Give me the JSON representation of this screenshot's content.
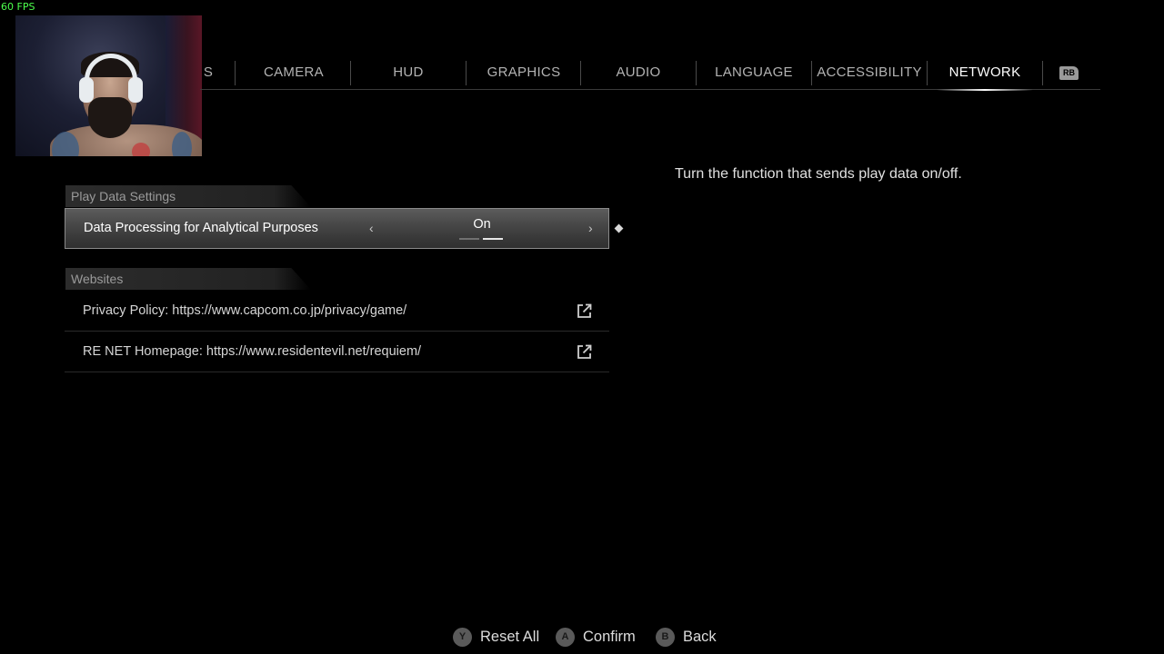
{
  "overlay": {
    "fps": "60 FPS"
  },
  "tabs": [
    {
      "label": "S"
    },
    {
      "label": "CAMERA"
    },
    {
      "label": "HUD"
    },
    {
      "label": "GRAPHICS"
    },
    {
      "label": "AUDIO"
    },
    {
      "label": "LANGUAGE"
    },
    {
      "label": "ACCESSIBILITY"
    },
    {
      "label": "NETWORK"
    }
  ],
  "active_tab": "NETWORK",
  "tab_next_button": "RB",
  "sections": {
    "play_data": {
      "header": "Play Data Settings",
      "setting": {
        "label": "Data Processing for Analytical Purposes",
        "value": "On",
        "left_arrow": "‹",
        "right_arrow": "›",
        "options_count": 2,
        "selected_index": 1
      }
    },
    "websites": {
      "header": "Websites",
      "links": [
        {
          "label": "Privacy Policy: https://www.capcom.co.jp/privacy/game/",
          "icon": "external-link-icon"
        },
        {
          "label": "RE NET Homepage: https://www.residentevil.net/requiem/",
          "icon": "external-link-icon"
        }
      ]
    }
  },
  "description": "Turn the function that sends play data on/off.",
  "footer": {
    "reset": {
      "button": "Y",
      "label": "Reset All"
    },
    "confirm": {
      "button": "A",
      "label": "Confirm"
    },
    "back": {
      "button": "B",
      "label": "Back"
    }
  },
  "colors": {
    "background": "#000000",
    "active_tab": "#ffffff",
    "inactive_tab": "#b3b3b3",
    "fps_overlay": "#4cff4c"
  }
}
